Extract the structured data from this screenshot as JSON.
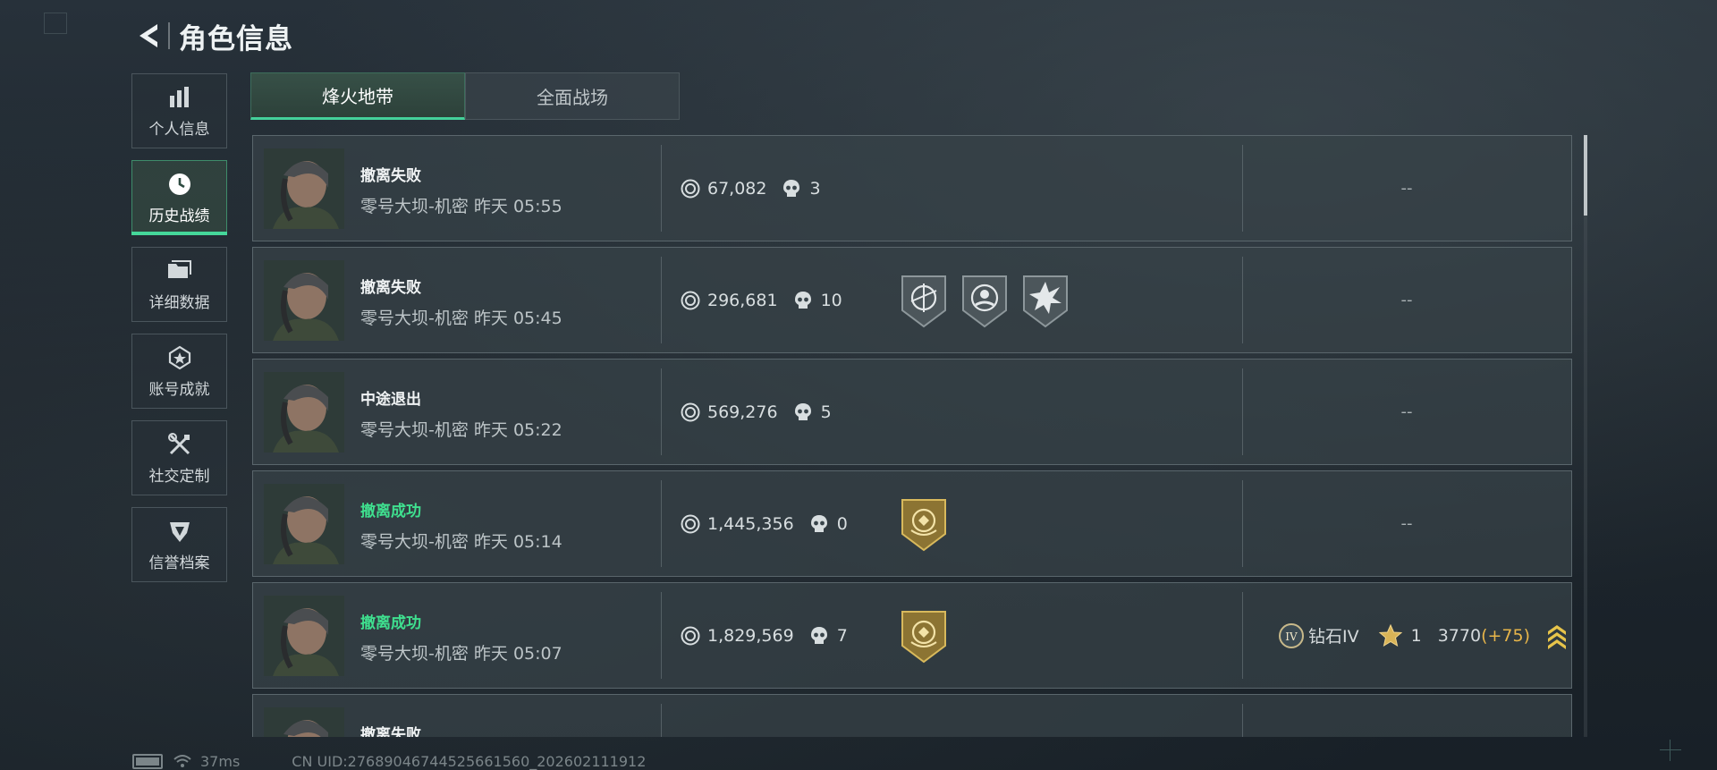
{
  "header": {
    "title": "角色信息"
  },
  "sidebar": {
    "items": [
      {
        "label": "个人信息",
        "icon": "bar-chart-icon",
        "active": false
      },
      {
        "label": "历史战绩",
        "icon": "clock-icon",
        "active": true
      },
      {
        "label": "详细数据",
        "icon": "folder-icon",
        "active": false
      },
      {
        "label": "账号成就",
        "icon": "achievement-icon",
        "active": false
      },
      {
        "label": "社交定制",
        "icon": "tools-icon",
        "active": false
      },
      {
        "label": "信誉档案",
        "icon": "shield-icon",
        "active": false
      }
    ]
  },
  "tabs": [
    {
      "label": "烽火地带",
      "active": true
    },
    {
      "label": "全面战场",
      "active": false
    }
  ],
  "matches": [
    {
      "status": "撤离失败",
      "success": false,
      "map": "零号大坝-机密",
      "day": "昨天",
      "time": "05:55",
      "value": "67,082",
      "kills": "3",
      "badges": [],
      "rank": "--"
    },
    {
      "status": "撤离失败",
      "success": false,
      "map": "零号大坝-机密",
      "day": "昨天",
      "time": "05:45",
      "value": "296,681",
      "kills": "10",
      "badges": [
        "sniper-medal-icon",
        "crosshair-medal-icon",
        "explosion-medal-icon"
      ],
      "rank": "--"
    },
    {
      "status": "中途退出",
      "success": false,
      "map": "零号大坝-机密",
      "day": "昨天",
      "time": "05:22",
      "value": "569,276",
      "kills": "5",
      "badges": [],
      "rank": "--"
    },
    {
      "status": "撤离成功",
      "success": true,
      "map": "零号大坝-机密",
      "day": "昨天",
      "time": "05:14",
      "value": "1,445,356",
      "kills": "0",
      "badges": [
        "gold-extract-medal-icon"
      ],
      "rank": "--"
    },
    {
      "status": "撤离成功",
      "success": true,
      "map": "零号大坝-机密",
      "day": "昨天",
      "time": "05:07",
      "value": "1,829,569",
      "kills": "7",
      "badges": [
        "gold-extract-medal-icon"
      ],
      "rank": null,
      "rank_info": {
        "tier_icon_text": "IV",
        "tier_name": "钻石IV",
        "stars": "1",
        "score": "3770",
        "delta": "(+75)"
      }
    },
    {
      "status": "撤离失败",
      "success": false,
      "map": "",
      "day": "",
      "time": "",
      "value": "",
      "kills": "",
      "badges": [],
      "rank": ""
    }
  ],
  "footer": {
    "ping": "37ms",
    "uid": "CN UID:276890467445256615​60_202602111912"
  },
  "colors": {
    "accent_green": "#45d79a",
    "gold": "#e7b54a"
  }
}
